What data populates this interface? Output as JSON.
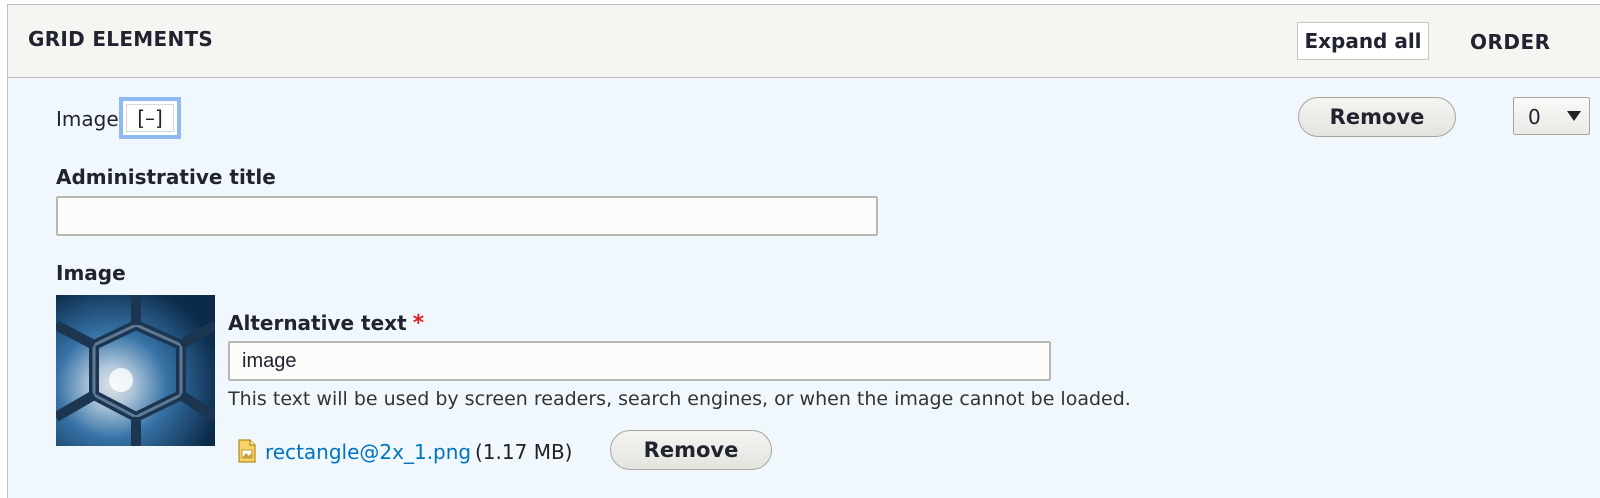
{
  "section": {
    "title": "GRID ELEMENTS",
    "expand_all_label": "Expand all",
    "order_label": "ORDER"
  },
  "row": {
    "title": "Image",
    "collapse_label": "[–]",
    "remove_label": "Remove",
    "weight_value": "0"
  },
  "admin_title": {
    "label": "Administrative title",
    "value": ""
  },
  "image_field": {
    "label": "Image",
    "thumbnail_icon": "space-station-window-image",
    "alt_label": "Alternative text",
    "required_marker": "*",
    "alt_value": "image",
    "alt_help": "This text will be used by screen readers, search engines, or when the image cannot be loaded.",
    "file_icon": "image-file-icon",
    "file_name": "rectangle@2x_1.png",
    "file_size": "(1.17 MB)",
    "remove_label": "Remove"
  },
  "colors": {
    "header_bg": "#f5f5f2",
    "body_bg": "#f0f8fe",
    "link": "#0074bd",
    "required": "#dc2323",
    "focus": "#8eb9f2"
  }
}
